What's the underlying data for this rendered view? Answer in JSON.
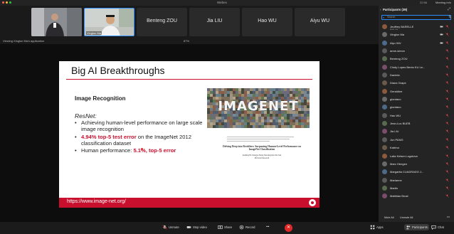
{
  "window": {
    "app_name": "Webex",
    "time": "22:56",
    "meeting_info": "Meeting info"
  },
  "video_strip": {
    "tiles": [
      {
        "type": "video",
        "label": ""
      },
      {
        "type": "video",
        "label": "Xinglun Ma"
      },
      {
        "type": "name",
        "label": "Benteng ZOU"
      },
      {
        "type": "name",
        "label": "Jia LIU"
      },
      {
        "type": "name",
        "label": "Hao WU"
      },
      {
        "type": "name",
        "label": "Aiyu WU"
      }
    ]
  },
  "share": {
    "viewing_label": "Viewing Xinglun Ma's application",
    "zoom": "87%"
  },
  "slide": {
    "title": "Big AI Breakthroughs",
    "subtitle": "Image Recognition",
    "model": "ResNet:",
    "bullets": {
      "b1": "Achieving human-level performance on large scale image recognition",
      "b2_bold": "4.94% top-5 test error",
      "b2_rest": " on the ImageNet 2012 classification dataset",
      "b3_plain": "Human performance: ",
      "b3_bold": "5.1%, top-5 error"
    },
    "logo": "IMAGENET",
    "paper_title": "Delving Deep into Rectifiers: Surpassing Human-Level Performance on ImageNet Classification",
    "paper_authors": "Kaiming He    Xiangyu Zhang    Shaoqing Ren    Jian Sun",
    "paper_affiliation": "Microsoft Research",
    "url": "https://www.image-net.org/"
  },
  "toolbar": {
    "unmute": "Unmute",
    "stop_video": "Stop video",
    "share": "Share",
    "record": "Record",
    "apps": "Apps",
    "participants": "Participants",
    "chat": "Chat"
  },
  "panel": {
    "title": "Participants (39)",
    "search_placeholder": "Search",
    "mute_all": "Mute All",
    "unmute_all": "Unmute All",
    "participants": [
      {
        "name": "Jeuffrey BARELLE",
        "sub": "Host, me"
      },
      {
        "name": "Xinglun Ma",
        "sub": ""
      },
      {
        "name": "Aiyu WU",
        "sub": ""
      },
      {
        "name": "anne-simon",
        "sub": ""
      },
      {
        "name": "Benteng ZOU",
        "sub": ""
      },
      {
        "name": "Cindy Lopes Bento KU Le...",
        "sub": ""
      },
      {
        "name": "Daniela",
        "sub": ""
      },
      {
        "name": "Diana Grape",
        "sub": ""
      },
      {
        "name": "Geraldine",
        "sub": ""
      },
      {
        "name": "giordano",
        "sub": ""
      },
      {
        "name": "giordano",
        "sub": ""
      },
      {
        "name": "Hao WU",
        "sub": ""
      },
      {
        "name": "Jean-Luc BUEB",
        "sub": ""
      },
      {
        "name": "Jia LIU",
        "sub": ""
      },
      {
        "name": "Jun PANG",
        "sub": ""
      },
      {
        "name": "Katrina",
        "sub": ""
      },
      {
        "name": "Laila Keiser-Logutova",
        "sub": ""
      },
      {
        "name": "Marc Hengen",
        "sub": ""
      },
      {
        "name": "Margarita CUADRADO J...",
        "sub": ""
      },
      {
        "name": "Marianne",
        "sub": ""
      },
      {
        "name": "Martin",
        "sub": ""
      },
      {
        "name": "Matthias Brust",
        "sub": ""
      }
    ]
  }
}
